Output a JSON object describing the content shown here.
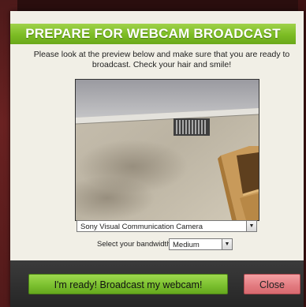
{
  "dialog": {
    "title": "PREPARE FOR WEBCAM BROADCAST",
    "intro_line1": "Please look at the preview below and make sure that you are ready to",
    "intro_line2": "broadcast.  Check your hair and smile!"
  },
  "camera_select": {
    "selected": "Sony Visual Communication Camera"
  },
  "bandwidth": {
    "label": "Select your bandwidth",
    "selected": "Medium"
  },
  "buttons": {
    "ready": "I'm ready! Broadcast my webcam!",
    "close": "Close"
  },
  "colors": {
    "header_green": "#7cbc24",
    "ready_green": "#7cc130",
    "close_red": "#e27a7f",
    "footer_dark": "#2e2e2e",
    "panel_bg": "#f1efe6"
  }
}
